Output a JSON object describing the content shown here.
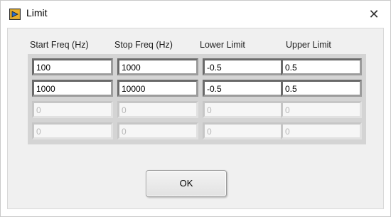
{
  "window": {
    "title": "Limit",
    "close_symbol": "✕",
    "icon": "labview-vi-icon"
  },
  "table": {
    "columns": [
      "Start Freq (Hz)",
      "Stop Freq (Hz)",
      "Lower Limit",
      "Upper Limit"
    ],
    "rows": [
      {
        "enabled": true,
        "cells": [
          "100",
          "1000",
          "-0.5",
          "0.5"
        ]
      },
      {
        "enabled": true,
        "cells": [
          "1000",
          "10000",
          "-0.5",
          "0.5"
        ]
      },
      {
        "enabled": false,
        "cells": [
          "0",
          "0",
          "0",
          "0"
        ]
      },
      {
        "enabled": false,
        "cells": [
          "0",
          "0",
          "0",
          "0"
        ]
      }
    ]
  },
  "buttons": {
    "ok_label": "OK"
  }
}
